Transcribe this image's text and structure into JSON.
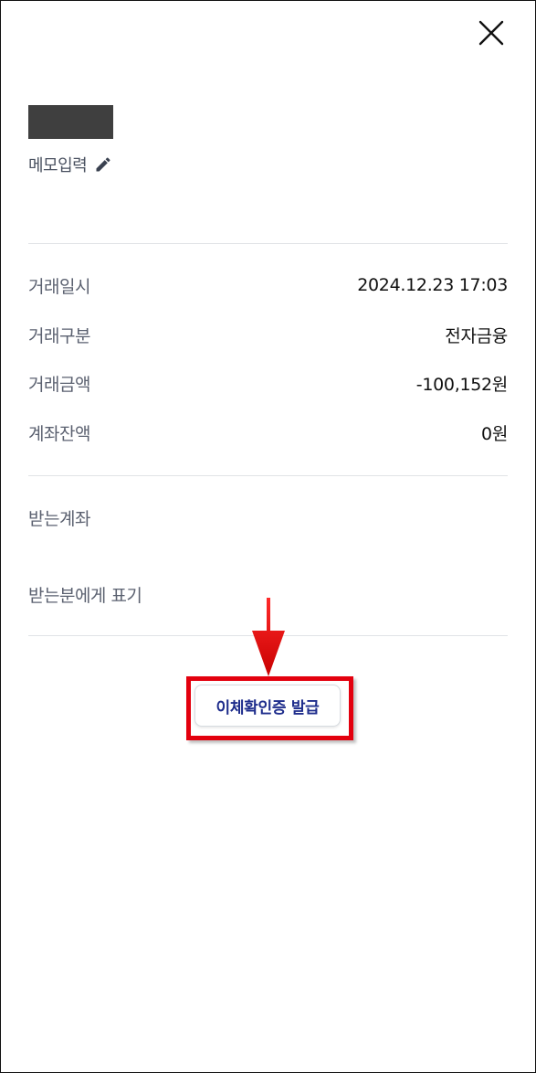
{
  "header": {
    "close_icon": "close-icon"
  },
  "memo": {
    "label": "메모입력",
    "icon": "pencil-icon"
  },
  "details": [
    {
      "label": "거래일시",
      "value": "2024.12.23 17:03"
    },
    {
      "label": "거래구분",
      "value": "전자금융"
    },
    {
      "label": "거래금액",
      "value": "-100,152원"
    },
    {
      "label": "계좌잔액",
      "value": "0원"
    }
  ],
  "receive": {
    "account_label": "받는계좌",
    "display_label": "받는분에게 표기"
  },
  "actions": {
    "issue_certificate_label": "이체확인증 발급"
  },
  "colors": {
    "accent_text": "#1e2d8c",
    "highlight": "#e3000e",
    "divider": "#e1e3e6"
  }
}
